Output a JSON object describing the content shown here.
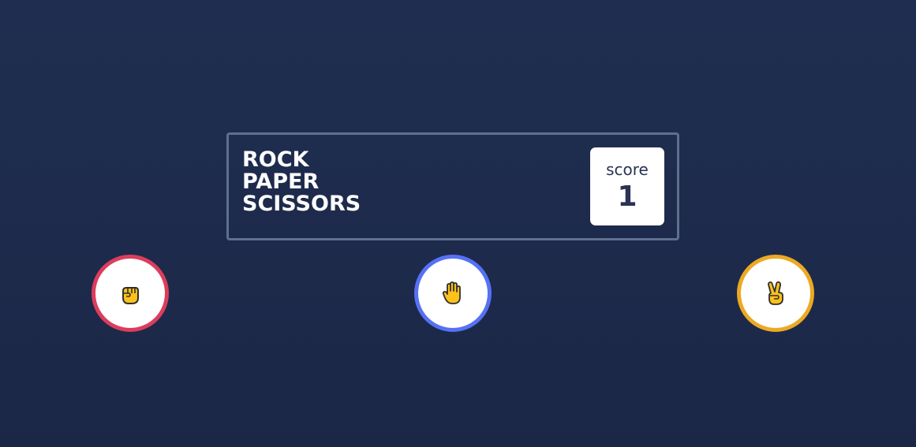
{
  "header": {
    "title_lines": [
      "ROCK",
      "PAPER",
      "SCISSORS"
    ],
    "score_label": "score",
    "score_value": "1"
  },
  "choices": [
    {
      "name": "rock",
      "icon": "raised-fist-icon",
      "border_color": "#dc3d5c"
    },
    {
      "name": "paper",
      "icon": "raised-hand-icon",
      "border_color": "#5671f5"
    },
    {
      "name": "scissors",
      "icon": "victory-hand-icon",
      "border_color": "#eca923"
    }
  ],
  "colors": {
    "background": "#1f2e50",
    "header_border": "#5f6f8e",
    "score_text": "#2a3356"
  }
}
